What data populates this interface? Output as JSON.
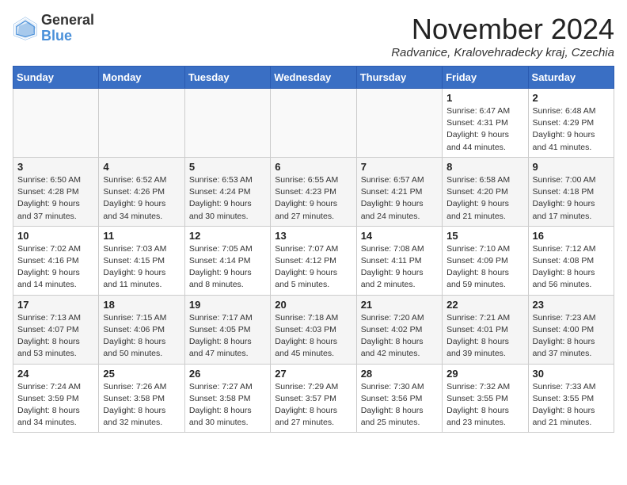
{
  "header": {
    "logo_general": "General",
    "logo_blue": "Blue",
    "month_title": "November 2024",
    "location": "Radvanice, Kralovehradecky kraj, Czechia"
  },
  "days_of_week": [
    "Sunday",
    "Monday",
    "Tuesday",
    "Wednesday",
    "Thursday",
    "Friday",
    "Saturday"
  ],
  "weeks": [
    [
      {
        "day": "",
        "info": ""
      },
      {
        "day": "",
        "info": ""
      },
      {
        "day": "",
        "info": ""
      },
      {
        "day": "",
        "info": ""
      },
      {
        "day": "",
        "info": ""
      },
      {
        "day": "1",
        "info": "Sunrise: 6:47 AM\nSunset: 4:31 PM\nDaylight: 9 hours\nand 44 minutes."
      },
      {
        "day": "2",
        "info": "Sunrise: 6:48 AM\nSunset: 4:29 PM\nDaylight: 9 hours\nand 41 minutes."
      }
    ],
    [
      {
        "day": "3",
        "info": "Sunrise: 6:50 AM\nSunset: 4:28 PM\nDaylight: 9 hours\nand 37 minutes."
      },
      {
        "day": "4",
        "info": "Sunrise: 6:52 AM\nSunset: 4:26 PM\nDaylight: 9 hours\nand 34 minutes."
      },
      {
        "day": "5",
        "info": "Sunrise: 6:53 AM\nSunset: 4:24 PM\nDaylight: 9 hours\nand 30 minutes."
      },
      {
        "day": "6",
        "info": "Sunrise: 6:55 AM\nSunset: 4:23 PM\nDaylight: 9 hours\nand 27 minutes."
      },
      {
        "day": "7",
        "info": "Sunrise: 6:57 AM\nSunset: 4:21 PM\nDaylight: 9 hours\nand 24 minutes."
      },
      {
        "day": "8",
        "info": "Sunrise: 6:58 AM\nSunset: 4:20 PM\nDaylight: 9 hours\nand 21 minutes."
      },
      {
        "day": "9",
        "info": "Sunrise: 7:00 AM\nSunset: 4:18 PM\nDaylight: 9 hours\nand 17 minutes."
      }
    ],
    [
      {
        "day": "10",
        "info": "Sunrise: 7:02 AM\nSunset: 4:16 PM\nDaylight: 9 hours\nand 14 minutes."
      },
      {
        "day": "11",
        "info": "Sunrise: 7:03 AM\nSunset: 4:15 PM\nDaylight: 9 hours\nand 11 minutes."
      },
      {
        "day": "12",
        "info": "Sunrise: 7:05 AM\nSunset: 4:14 PM\nDaylight: 9 hours\nand 8 minutes."
      },
      {
        "day": "13",
        "info": "Sunrise: 7:07 AM\nSunset: 4:12 PM\nDaylight: 9 hours\nand 5 minutes."
      },
      {
        "day": "14",
        "info": "Sunrise: 7:08 AM\nSunset: 4:11 PM\nDaylight: 9 hours\nand 2 minutes."
      },
      {
        "day": "15",
        "info": "Sunrise: 7:10 AM\nSunset: 4:09 PM\nDaylight: 8 hours\nand 59 minutes."
      },
      {
        "day": "16",
        "info": "Sunrise: 7:12 AM\nSunset: 4:08 PM\nDaylight: 8 hours\nand 56 minutes."
      }
    ],
    [
      {
        "day": "17",
        "info": "Sunrise: 7:13 AM\nSunset: 4:07 PM\nDaylight: 8 hours\nand 53 minutes."
      },
      {
        "day": "18",
        "info": "Sunrise: 7:15 AM\nSunset: 4:06 PM\nDaylight: 8 hours\nand 50 minutes."
      },
      {
        "day": "19",
        "info": "Sunrise: 7:17 AM\nSunset: 4:05 PM\nDaylight: 8 hours\nand 47 minutes."
      },
      {
        "day": "20",
        "info": "Sunrise: 7:18 AM\nSunset: 4:03 PM\nDaylight: 8 hours\nand 45 minutes."
      },
      {
        "day": "21",
        "info": "Sunrise: 7:20 AM\nSunset: 4:02 PM\nDaylight: 8 hours\nand 42 minutes."
      },
      {
        "day": "22",
        "info": "Sunrise: 7:21 AM\nSunset: 4:01 PM\nDaylight: 8 hours\nand 39 minutes."
      },
      {
        "day": "23",
        "info": "Sunrise: 7:23 AM\nSunset: 4:00 PM\nDaylight: 8 hours\nand 37 minutes."
      }
    ],
    [
      {
        "day": "24",
        "info": "Sunrise: 7:24 AM\nSunset: 3:59 PM\nDaylight: 8 hours\nand 34 minutes."
      },
      {
        "day": "25",
        "info": "Sunrise: 7:26 AM\nSunset: 3:58 PM\nDaylight: 8 hours\nand 32 minutes."
      },
      {
        "day": "26",
        "info": "Sunrise: 7:27 AM\nSunset: 3:58 PM\nDaylight: 8 hours\nand 30 minutes."
      },
      {
        "day": "27",
        "info": "Sunrise: 7:29 AM\nSunset: 3:57 PM\nDaylight: 8 hours\nand 27 minutes."
      },
      {
        "day": "28",
        "info": "Sunrise: 7:30 AM\nSunset: 3:56 PM\nDaylight: 8 hours\nand 25 minutes."
      },
      {
        "day": "29",
        "info": "Sunrise: 7:32 AM\nSunset: 3:55 PM\nDaylight: 8 hours\nand 23 minutes."
      },
      {
        "day": "30",
        "info": "Sunrise: 7:33 AM\nSunset: 3:55 PM\nDaylight: 8 hours\nand 21 minutes."
      }
    ]
  ]
}
